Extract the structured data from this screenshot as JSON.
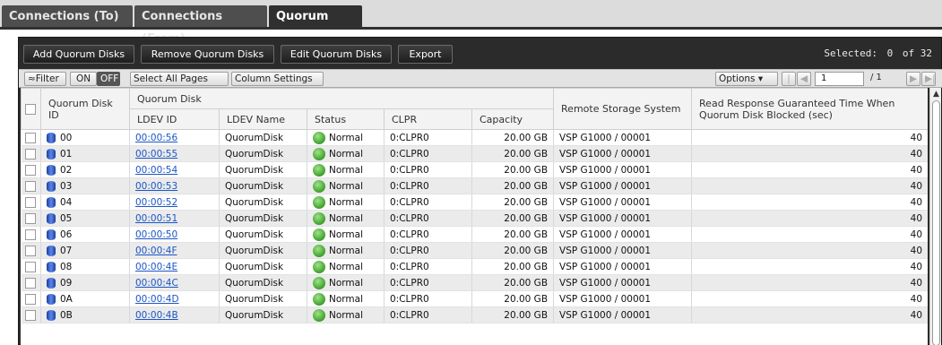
{
  "tabs": [
    {
      "label": "Connections (To)",
      "active": false
    },
    {
      "label": "Connections (From)",
      "active": false
    },
    {
      "label": "Quorum Disks",
      "active": true
    }
  ],
  "toolbar": {
    "add_label": "Add Quorum Disks",
    "remove_label": "Remove Quorum Disks",
    "edit_label": "Edit Quorum Disks",
    "export_label": "Export",
    "selected_label": "Selected:",
    "selected_count": "0",
    "selected_total": "of 32"
  },
  "subbar": {
    "filter_label": "≈Filter",
    "on_label": "ON",
    "off_label": "OFF",
    "select_all_label": "Select All Pages",
    "column_settings_label": "Column Settings",
    "options_label": "Options ▾",
    "page_value": "1",
    "page_total": "/ 1"
  },
  "table": {
    "headers": {
      "quorum_disk_id": "Quorum Disk ID",
      "quorum_disk_group": "Quorum Disk",
      "ldev_id": "LDEV ID",
      "ldev_name": "LDEV Name",
      "status": "Status",
      "clpr": "CLPR",
      "capacity": "Capacity",
      "remote_storage": "Remote Storage System",
      "read_response": "Read Response Guaranteed Time When Quorum Disk Blocked (sec)"
    },
    "rows": [
      {
        "id": "00",
        "ldev": "00:00:56",
        "name": "QuorumDisk",
        "status": "Normal",
        "clpr": "0:CLPR0",
        "capacity": "20.00 GB",
        "remote": "VSP G1000 / 00001",
        "time": "40"
      },
      {
        "id": "01",
        "ldev": "00:00:55",
        "name": "QuorumDisk",
        "status": "Normal",
        "clpr": "0:CLPR0",
        "capacity": "20.00 GB",
        "remote": "VSP G1000 / 00001",
        "time": "40"
      },
      {
        "id": "02",
        "ldev": "00:00:54",
        "name": "QuorumDisk",
        "status": "Normal",
        "clpr": "0:CLPR0",
        "capacity": "20.00 GB",
        "remote": "VSP G1000 / 00001",
        "time": "40"
      },
      {
        "id": "03",
        "ldev": "00:00:53",
        "name": "QuorumDisk",
        "status": "Normal",
        "clpr": "0:CLPR0",
        "capacity": "20.00 GB",
        "remote": "VSP G1000 / 00001",
        "time": "40"
      },
      {
        "id": "04",
        "ldev": "00:00:52",
        "name": "QuorumDisk",
        "status": "Normal",
        "clpr": "0:CLPR0",
        "capacity": "20.00 GB",
        "remote": "VSP G1000 / 00001",
        "time": "40"
      },
      {
        "id": "05",
        "ldev": "00:00:51",
        "name": "QuorumDisk",
        "status": "Normal",
        "clpr": "0:CLPR0",
        "capacity": "20.00 GB",
        "remote": "VSP G1000 / 00001",
        "time": "40"
      },
      {
        "id": "06",
        "ldev": "00:00:50",
        "name": "QuorumDisk",
        "status": "Normal",
        "clpr": "0:CLPR0",
        "capacity": "20.00 GB",
        "remote": "VSP G1000 / 00001",
        "time": "40"
      },
      {
        "id": "07",
        "ldev": "00:00:4F",
        "name": "QuorumDisk",
        "status": "Normal",
        "clpr": "0:CLPR0",
        "capacity": "20.00 GB",
        "remote": "VSP G1000 / 00001",
        "time": "40"
      },
      {
        "id": "08",
        "ldev": "00:00:4E",
        "name": "QuorumDisk",
        "status": "Normal",
        "clpr": "0:CLPR0",
        "capacity": "20.00 GB",
        "remote": "VSP G1000 / 00001",
        "time": "40"
      },
      {
        "id": "09",
        "ldev": "00:00:4C",
        "name": "QuorumDisk",
        "status": "Normal",
        "clpr": "0:CLPR0",
        "capacity": "20.00 GB",
        "remote": "VSP G1000 / 00001",
        "time": "40"
      },
      {
        "id": "0A",
        "ldev": "00:00:4D",
        "name": "QuorumDisk",
        "status": "Normal",
        "clpr": "0:CLPR0",
        "capacity": "20.00 GB",
        "remote": "VSP G1000 / 00001",
        "time": "40"
      },
      {
        "id": "0B",
        "ldev": "00:00:4B",
        "name": "QuorumDisk",
        "status": "Normal",
        "clpr": "0:CLPR0",
        "capacity": "20.00 GB",
        "remote": "VSP G1000 / 00001",
        "time": "40"
      }
    ]
  },
  "icons": {
    "row_icon": "quorum-disk-icon",
    "status_icon": "status-normal-icon",
    "page_first": "page-first-icon",
    "page_prev": "page-prev-icon",
    "page_next": "page-next-icon",
    "page_last": "page-last-icon"
  },
  "colors": {
    "panel_bg": "#2b2b2b",
    "link": "#1a56c4",
    "status_normal": "#3f9f2c"
  }
}
